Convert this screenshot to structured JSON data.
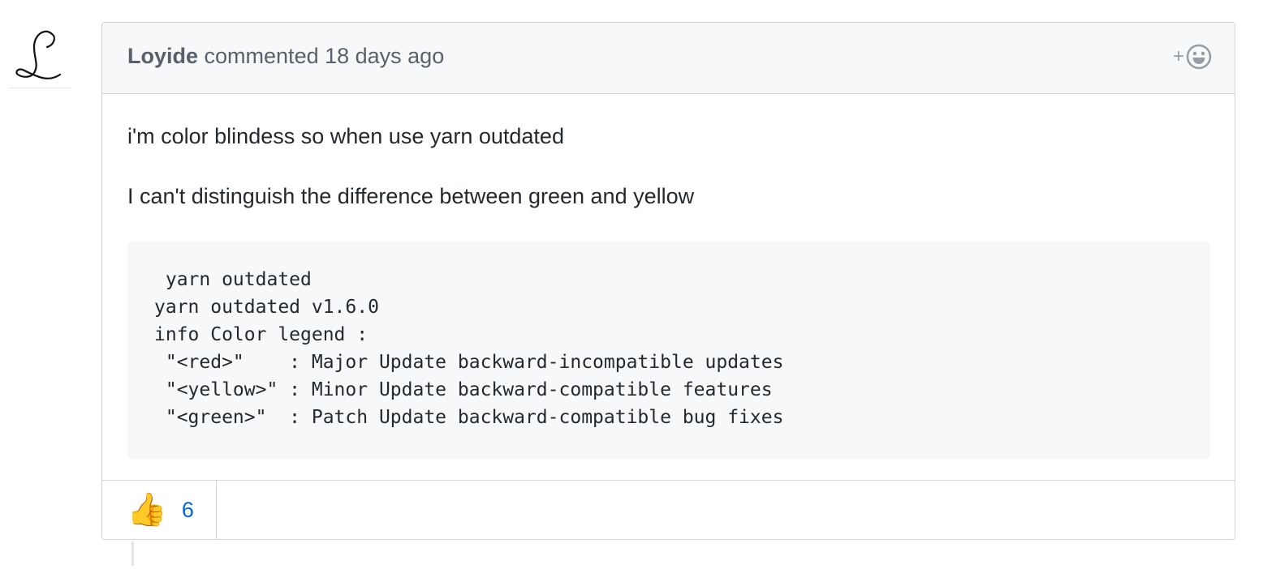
{
  "comment": {
    "author": "Loyide",
    "action_text": "commented 18 days ago",
    "reaction_picker_plus": "+",
    "body": {
      "paragraphs": [
        "i'm color blindess so when use yarn outdated",
        "I can't distinguish the difference between green and yellow"
      ],
      "code": " yarn outdated\nyarn outdated v1.6.0\ninfo Color legend :\n \"<red>\"    : Major Update backward-incompatible updates\n \"<yellow>\" : Minor Update backward-compatible features\n \"<green>\"  : Patch Update backward-compatible bug fixes"
    },
    "reactions": [
      {
        "emoji": "👍",
        "icon": "thumbs-up-icon",
        "count": "6"
      }
    ]
  },
  "colors": {
    "header_bg": "#f6f8fa",
    "border": "#d1d5da",
    "link": "#0366d6",
    "muted": "#586069"
  }
}
